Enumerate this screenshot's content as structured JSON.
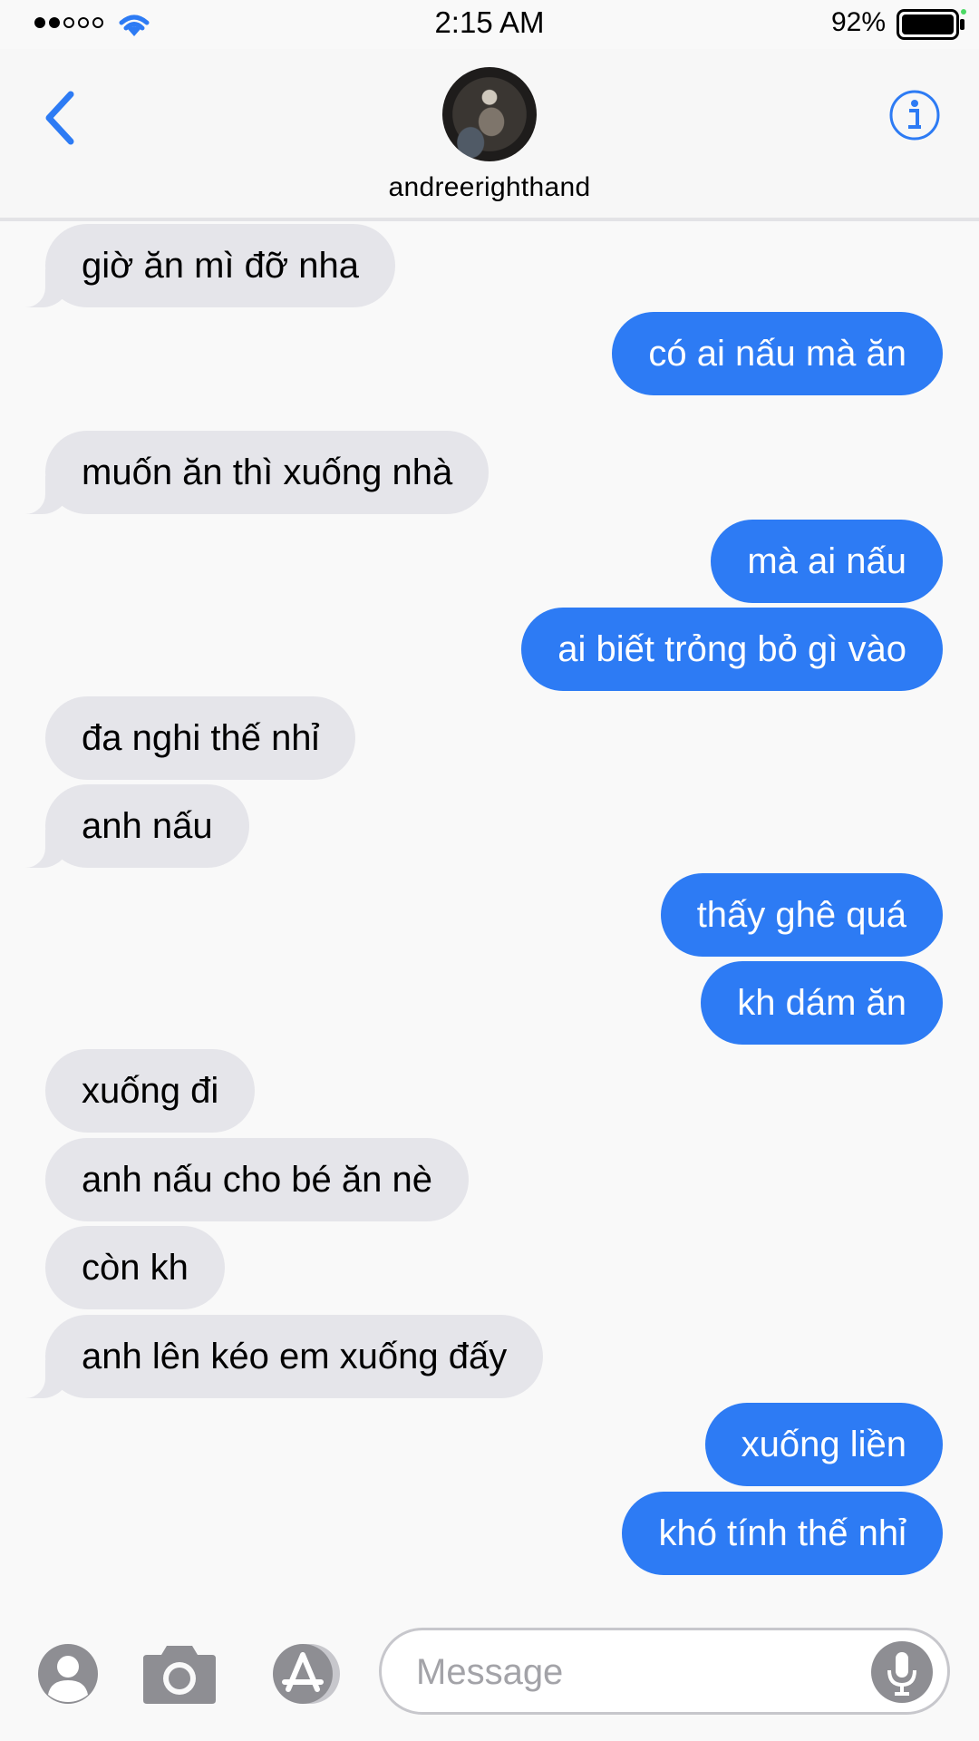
{
  "status_bar": {
    "time": "2:15 AM",
    "battery_percent": "92%",
    "signal_bars": 2,
    "signal_total": 5
  },
  "header": {
    "contact_name": "andreerighthand",
    "back_icon": "chevron-left-icon",
    "info_icon": "info-icon"
  },
  "colors": {
    "accent": "#2d7bf4",
    "received_bubble": "#e5e5ea",
    "background": "#f9f9f9"
  },
  "messages": [
    {
      "text": "giờ ăn mì đỡ nha",
      "from": "received"
    },
    {
      "text": "có ai nấu mà ăn",
      "from": "sent"
    },
    {
      "text": "muốn ăn thì xuống nhà",
      "from": "received"
    },
    {
      "text": "mà ai nấu",
      "from": "sent"
    },
    {
      "text": "ai biết trỏng bỏ gì vào",
      "from": "sent"
    },
    {
      "text": "đa nghi thế nhỉ",
      "from": "received"
    },
    {
      "text": "anh nấu",
      "from": "received"
    },
    {
      "text": "thấy ghê quá",
      "from": "sent"
    },
    {
      "text": "kh dám ăn",
      "from": "sent"
    },
    {
      "text": "xuống đi",
      "from": "received"
    },
    {
      "text": "anh nấu cho bé ăn nè",
      "from": "received"
    },
    {
      "text": "còn kh",
      "from": "received"
    },
    {
      "text": "anh lên kéo em xuống đấy",
      "from": "received"
    },
    {
      "text": "xuống liền",
      "from": "sent"
    },
    {
      "text": "khó tính thế nhỉ",
      "from": "sent"
    }
  ],
  "input_bar": {
    "placeholder": "Message",
    "icons": [
      "contact-icon",
      "camera-icon",
      "app-store-icon",
      "mic-icon"
    ]
  }
}
